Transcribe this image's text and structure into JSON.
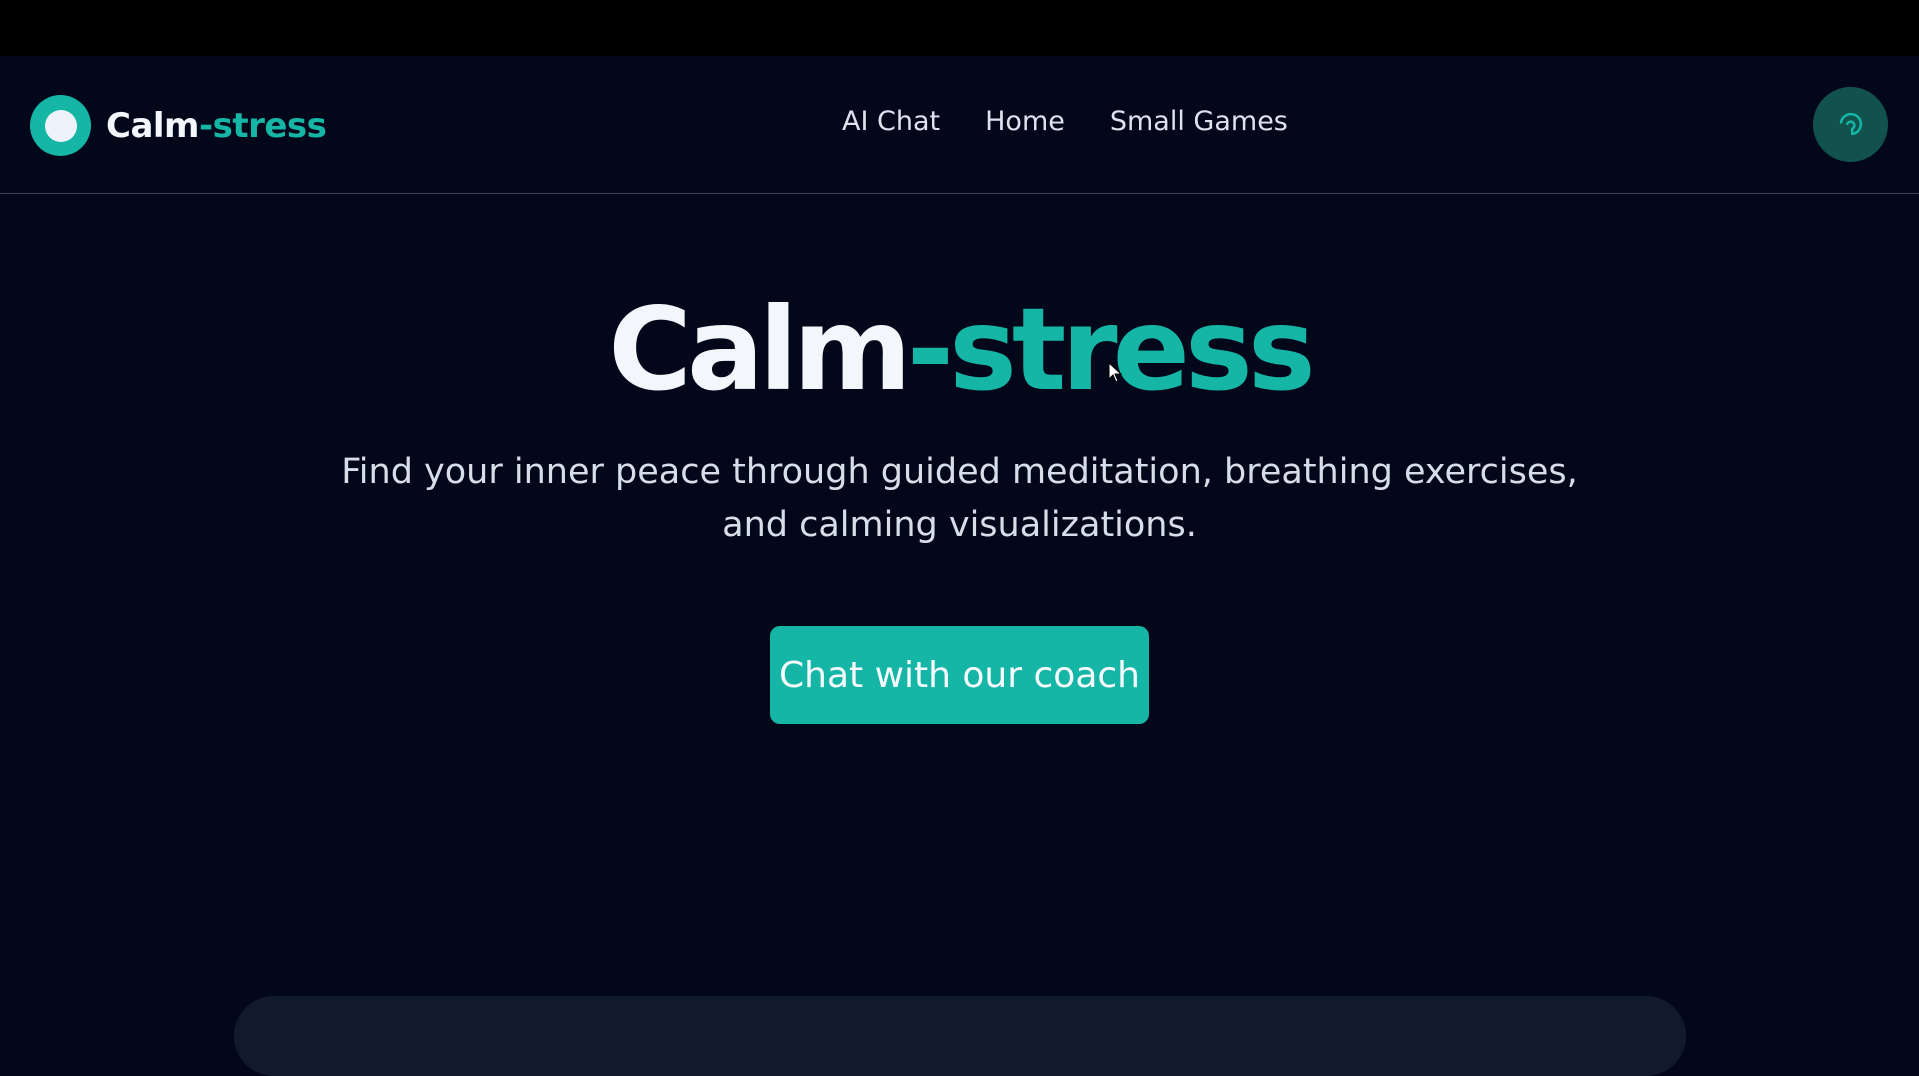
{
  "colors": {
    "accent": "#15b6a6",
    "background": "#03071a",
    "text_light": "#f3f6fb"
  },
  "logo": {
    "part1": "Calm",
    "part2": "-stress",
    "icon": "circle-logo-icon"
  },
  "nav": {
    "items": [
      {
        "label": "AI Chat"
      },
      {
        "label": "Home"
      },
      {
        "label": "Small Games"
      }
    ]
  },
  "theme_toggle": {
    "icon": "swirl-icon"
  },
  "hero": {
    "title_part1": "Calm",
    "title_part2": "-stress",
    "subtitle": "Find your inner peace through guided meditation, breathing exercises, and calming visualizations.",
    "cta_label": "Chat with our coach"
  }
}
